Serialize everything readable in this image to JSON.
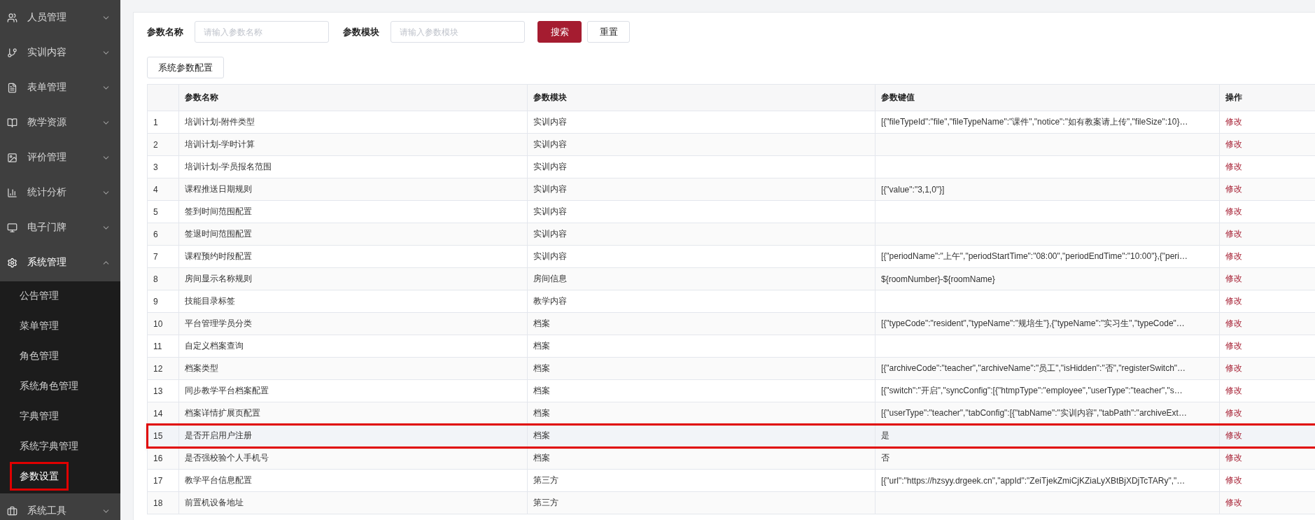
{
  "sidebar": {
    "items": [
      {
        "label": "人员管理",
        "expanded": false
      },
      {
        "label": "实训内容",
        "expanded": false
      },
      {
        "label": "表单管理",
        "expanded": false
      },
      {
        "label": "教学资源",
        "expanded": false
      },
      {
        "label": "评价管理",
        "expanded": false
      },
      {
        "label": "统计分析",
        "expanded": false
      },
      {
        "label": "电子门牌",
        "expanded": false
      },
      {
        "label": "系统管理",
        "expanded": true,
        "children": [
          {
            "label": "公告管理",
            "selected": false
          },
          {
            "label": "菜单管理",
            "selected": false
          },
          {
            "label": "角色管理",
            "selected": false
          },
          {
            "label": "系统角色管理",
            "selected": false
          },
          {
            "label": "字典管理",
            "selected": false
          },
          {
            "label": "系统字典管理",
            "selected": false
          },
          {
            "label": "参数设置",
            "selected": true
          }
        ]
      },
      {
        "label": "系统工具",
        "expanded": false
      }
    ]
  },
  "filters": [
    {
      "label": "参数名称",
      "placeholder": "请输入参数名称"
    },
    {
      "label": "参数模块",
      "placeholder": "请输入参数模块"
    }
  ],
  "buttons": [
    {
      "label": "搜索",
      "kind": "primary"
    },
    {
      "label": "重置",
      "kind": "default"
    }
  ],
  "toolbar_button": "系统参数配置",
  "table": {
    "columns": [
      "参数名称",
      "参数模块",
      "参数键值",
      "操作"
    ],
    "rows": [
      {
        "index": "1",
        "name": "培训计划-附件类型",
        "module": "实训内容",
        "value": "[{\"fileTypeId\":\"file\",\"fileTypeName\":\"课件\",\"notice\":\"如有教案请上传\",\"fileSize\":10}…",
        "action": "修改",
        "highlighted": false
      },
      {
        "index": "2",
        "name": "培训计划-学时计算",
        "module": "实训内容",
        "action": "修改",
        "highlighted": false
      },
      {
        "index": "3",
        "name": "培训计划-学员报名范围",
        "module": "实训内容",
        "action": "修改",
        "highlighted": false
      },
      {
        "index": "4",
        "name": "课程推送日期规则",
        "module": "实训内容",
        "value": "[{\"value\":\"3,1,0\"}]",
        "action": "修改",
        "highlighted": false
      },
      {
        "index": "5",
        "name": "签到时间范围配置",
        "module": "实训内容",
        "action": "修改",
        "highlighted": false
      },
      {
        "index": "6",
        "name": "签退时间范围配置",
        "module": "实训内容",
        "action": "修改",
        "highlighted": false
      },
      {
        "index": "7",
        "name": "课程预约时段配置",
        "module": "实训内容",
        "value": "[{\"periodName\":\"上午\",\"periodStartTime\":\"08:00\",\"periodEndTime\":\"10:00\"},{\"peri…",
        "action": "修改",
        "highlighted": false
      },
      {
        "index": "8",
        "name": "房间显示名称规则",
        "module": "房间信息",
        "value": "${roomNumber}-${roomName}",
        "action": "修改",
        "highlighted": false
      },
      {
        "index": "9",
        "name": "技能目录标签",
        "module": "教学内容",
        "action": "修改",
        "highlighted": false
      },
      {
        "index": "10",
        "name": "平台管理学员分类",
        "module": "档案",
        "value": "[{\"typeCode\":\"resident\",\"typeName\":\"规培生\"},{\"typeName\":\"实习生\",\"typeCode\"…",
        "action": "修改",
        "highlighted": false
      },
      {
        "index": "11",
        "name": "自定义档案查询",
        "module": "档案",
        "action": "修改",
        "highlighted": false
      },
      {
        "index": "12",
        "name": "档案类型",
        "module": "档案",
        "value": "[{\"archiveCode\":\"teacher\",\"archiveName\":\"员工\",\"isHidden\":\"否\",\"registerSwitch\"…",
        "action": "修改",
        "highlighted": false
      },
      {
        "index": "13",
        "name": "同步教学平台档案配置",
        "module": "档案",
        "value": "[{\"switch\":\"开启\",\"syncConfig\":[{\"htmpType\":\"employee\",\"userType\":\"teacher\",\"s…",
        "action": "修改",
        "highlighted": false
      },
      {
        "index": "14",
        "name": "档案详情扩展页配置",
        "module": "档案",
        "value": "[{\"userType\":\"teacher\",\"tabConfig\":[{\"tabName\":\"实训内容\",\"tabPath\":\"archiveExt…",
        "action": "修改",
        "highlighted": false
      },
      {
        "index": "15",
        "name": "是否开启用户注册",
        "module": "档案",
        "value": "是",
        "action": "修改",
        "highlighted": true
      },
      {
        "index": "16",
        "name": "是否强校验个人手机号",
        "module": "档案",
        "value": "否",
        "action": "修改",
        "highlighted": false
      },
      {
        "index": "17",
        "name": "教学平台信息配置",
        "module": "第三方",
        "value": "[{\"url\":\"https://hzsyy.drgeek.cn\",\"appId\":\"ZeiTjekZmiCjKZiaLyXBtBjXDjTcTARy\",\"…",
        "action": "修改",
        "highlighted": false
      },
      {
        "index": "18",
        "name": "前置机设备地址",
        "module": "第三方",
        "action": "修改",
        "highlighted": false
      }
    ]
  }
}
